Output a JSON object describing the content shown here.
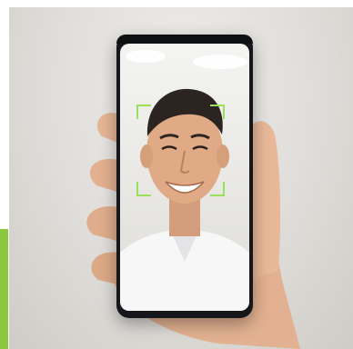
{
  "photo": {
    "subject": "smiling-man-face-scan",
    "icons": [
      "phone-icon",
      "face-scan-frame-icon"
    ]
  },
  "colors": {
    "accent": "#8cc63f",
    "scan_frame": "#9be05a",
    "phone_body": "#16171a",
    "background": "#dfddd9"
  },
  "scan": {
    "frame_corners": 4
  }
}
